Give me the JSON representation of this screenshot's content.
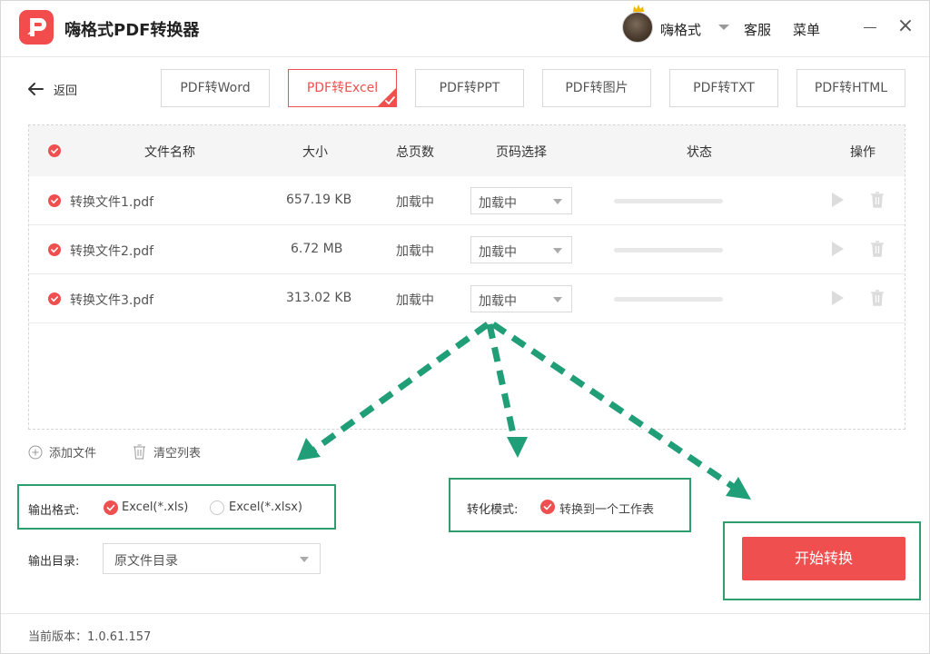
{
  "app": {
    "title": "嗨格式PDF转换器",
    "username": "嗨格式",
    "service_label": "客服",
    "menu_label": "菜单",
    "close_glyph": "×"
  },
  "nav": {
    "back_label": "返回",
    "tabs": [
      {
        "label": "PDF转Word",
        "active": false
      },
      {
        "label": "PDF转Excel",
        "active": true
      },
      {
        "label": "PDF转PPT",
        "active": false
      },
      {
        "label": "PDF转图片",
        "active": false
      },
      {
        "label": "PDF转TXT",
        "active": false
      },
      {
        "label": "PDF转HTML",
        "active": false
      }
    ]
  },
  "table": {
    "headers": {
      "name": "文件名称",
      "size": "大小",
      "pages": "总页数",
      "page_select": "页码选择",
      "status": "状态",
      "actions": "操作"
    },
    "rows": [
      {
        "name": "转换文件1.pdf",
        "size": "657.19 KB",
        "pages": "加载中",
        "page_select": "加载中",
        "progress": 0
      },
      {
        "name": "转换文件2.pdf",
        "size": "6.72 MB",
        "pages": "加载中",
        "page_select": "加载中",
        "progress": 0
      },
      {
        "name": "转换文件3.pdf",
        "size": "313.02 KB",
        "pages": "加载中",
        "page_select": "加载中",
        "progress": 0
      }
    ]
  },
  "list_actions": {
    "add_label": "添加文件",
    "clear_label": "清空列表"
  },
  "output": {
    "format_label": "输出格式:",
    "format_options": [
      {
        "label": "Excel(*.xls)",
        "selected": true
      },
      {
        "label": "Excel(*.xlsx)",
        "selected": false
      }
    ],
    "mode_label": "转化模式:",
    "mode_option": {
      "label": "转换到一个工作表",
      "selected": true
    },
    "dir_label": "输出目录:",
    "dir_value": "原文件目录"
  },
  "start_label": "开始转换",
  "footer": {
    "version_text": "当前版本：1.0.61.157"
  },
  "colors": {
    "accent": "#f04f4f",
    "highlight": "#2f9e6e",
    "arrow": "#1f9e78"
  },
  "icons": [
    "app-logo-icon",
    "crown-icon",
    "back-arrow-icon",
    "check-icon",
    "play-icon",
    "trash-icon",
    "add-circle-icon",
    "clear-list-icon",
    "chevron-down-icon",
    "close-icon",
    "minimize-icon"
  ]
}
